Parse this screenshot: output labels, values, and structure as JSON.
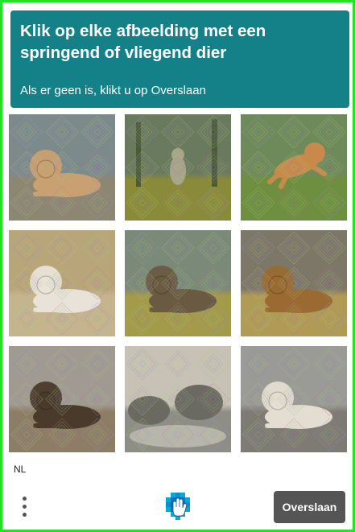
{
  "header": {
    "title": "Klik op elke afbeelding met een springend of vliegend dier",
    "subtitle": "Als er geen is, klikt u op Overslaan",
    "background_color": "#138187"
  },
  "grid": {
    "tiles": [
      {
        "subject": "lion lying on rocks",
        "palette": {
          "sky": "#7d8a8c",
          "ground": "#8c8672",
          "animal": "#c9a071"
        }
      },
      {
        "subject": "lion in sunlit forest",
        "palette": {
          "sky": "#6a7a5e",
          "ground": "#8a8b3a",
          "animal": "#a8a48a"
        }
      },
      {
        "subject": "lion leaping over grass",
        "palette": {
          "sky": "#6f8a5a",
          "ground": "#6e8f3f",
          "animal": "#c88a4a"
        }
      },
      {
        "subject": "white lion lying down",
        "palette": {
          "sky": "#b9a57a",
          "ground": "#c6b48e",
          "animal": "#e8e2d8"
        }
      },
      {
        "subject": "lion lying on grass",
        "palette": {
          "sky": "#7b8a78",
          "ground": "#a39a4a",
          "animal": "#6a5a42"
        }
      },
      {
        "subject": "lion lying in field",
        "palette": {
          "sky": "#7d7768",
          "ground": "#b09a55",
          "animal": "#9a6a32"
        }
      },
      {
        "subject": "dark-maned lion lying",
        "palette": {
          "sky": "#a09a92",
          "ground": "#8d7d66",
          "animal": "#4a3a2c"
        }
      },
      {
        "subject": "rocky stream",
        "palette": {
          "sky": "#c8c2b6",
          "ground": "#8e8e86",
          "animal": "#6a6a62"
        }
      },
      {
        "subject": "white lion on rocks",
        "palette": {
          "sky": "#9a9a96",
          "ground": "#7e7a74",
          "animal": "#e4ddd2"
        }
      }
    ]
  },
  "footer": {
    "language": "NL",
    "skip_label": "Overslaan",
    "menu_icon": "vertical-ellipsis",
    "logo_icon": "hcaptcha-logo",
    "skip_color": "#555555",
    "accent_frame_color": "#22e522"
  }
}
